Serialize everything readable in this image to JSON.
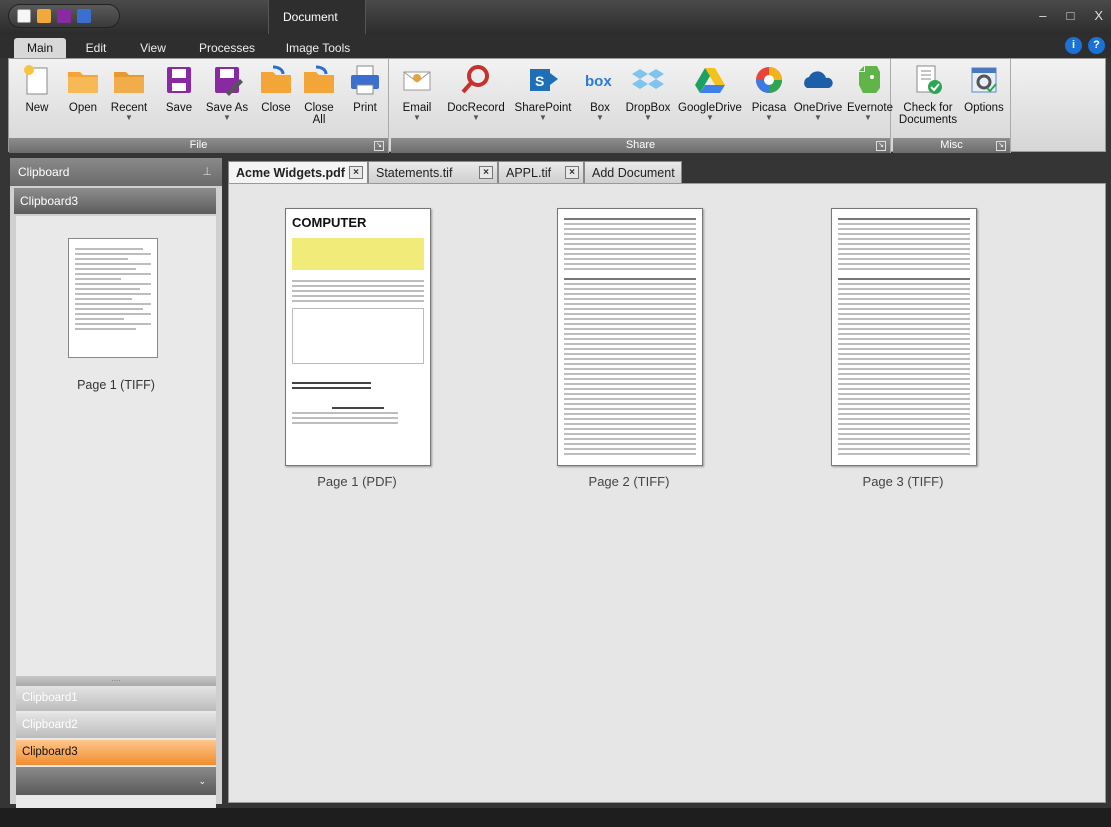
{
  "titlebar": {
    "document_title": "Document",
    "minimize": "–",
    "maximize": "□",
    "close": "X"
  },
  "ribbon_tabs": [
    "Main",
    "Edit",
    "View",
    "Processes",
    "Image Tools"
  ],
  "help": {
    "info": "i",
    "question": "?"
  },
  "ribbon": {
    "groups": {
      "file": "File",
      "share": "Share",
      "misc": "Misc"
    },
    "file_buttons": [
      "New",
      "Open",
      "Recent",
      "Save",
      "Save As",
      "Close",
      "Close All",
      "Print"
    ],
    "share_buttons": [
      "Email",
      "DocRecord",
      "SharePoint",
      "Box",
      "DropBox",
      "GoogleDrive",
      "Picasa",
      "OneDrive",
      "Evernote"
    ],
    "misc_buttons": [
      "Check for Documents",
      "Options"
    ]
  },
  "left_panel": {
    "header": "Clipboard",
    "active_clipboard": "Clipboard3",
    "thumb_label": "Page 1 (TIFF)",
    "clipboards": [
      "Clipboard1",
      "Clipboard2",
      "Clipboard3"
    ]
  },
  "doc_tabs": [
    "Acme Widgets.pdf",
    "Statements.tif",
    "APPL.tif",
    "Add Document"
  ],
  "pages": [
    {
      "label": "Page 1 (PDF)",
      "heading": "COMPUTER"
    },
    {
      "label": "Page 2 (TIFF)"
    },
    {
      "label": "Page 3 (TIFF)"
    }
  ],
  "colors": {
    "accent_orange": "#f28e30",
    "invoice_highlight": "#f1ec7a",
    "ribbon_group": "#7a7a7a"
  }
}
